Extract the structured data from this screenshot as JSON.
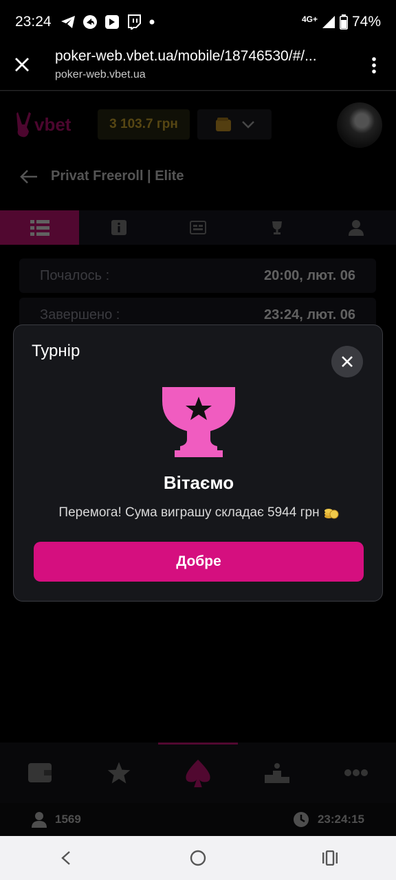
{
  "status_bar": {
    "time": "23:24",
    "network": "4G+",
    "battery": "74%"
  },
  "browser": {
    "url": "poker-web.vbet.ua/mobile/18746530/#/...",
    "domain": "poker-web.vbet.ua"
  },
  "app": {
    "logo": "vbet",
    "balance": "3 103.7 грн",
    "page_title": "Privat Freeroll | Elite",
    "info_rows": [
      {
        "label": "Почалось :",
        "value": "20:00, лют. 06"
      },
      {
        "label": "Завершено :",
        "value": "23:24, лют. 06"
      }
    ],
    "footer": {
      "players": "1569",
      "clock": "23:24:15"
    },
    "accent": "#d4167f"
  },
  "modal": {
    "title": "Турнір",
    "heading": "Вітаємо",
    "message": "Перемога! Сума виграшу складає 5944 грн",
    "button": "Добре",
    "trophy_color": "#f05cc0"
  }
}
